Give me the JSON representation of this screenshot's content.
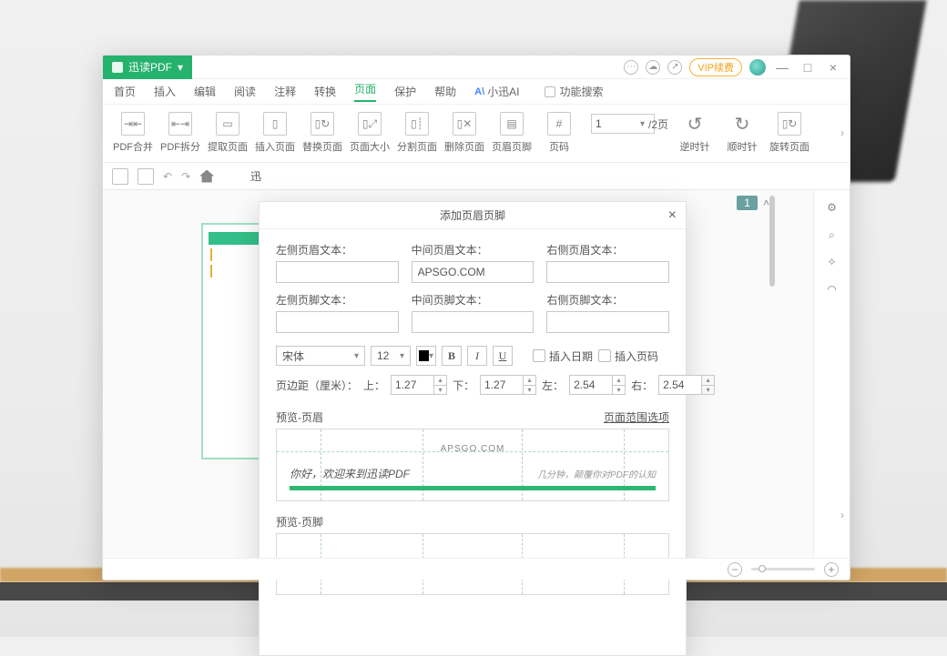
{
  "brand": "迅读PDF",
  "titlebar": {
    "vip": "VIP续费"
  },
  "menu": {
    "items": [
      "首页",
      "插入",
      "编辑",
      "阅读",
      "注释",
      "转换",
      "页面",
      "保护",
      "帮助"
    ],
    "active_index": 6,
    "ai": "小迅AI",
    "search_placeholder": "功能搜索"
  },
  "ribbon": {
    "items": [
      {
        "label": "PDF合并"
      },
      {
        "label": "PDF拆分"
      },
      {
        "label": "提取页面"
      },
      {
        "label": "插入页面"
      },
      {
        "label": "替换页面"
      },
      {
        "label": "页面大小"
      },
      {
        "label": "分割页面"
      },
      {
        "label": "删除页面"
      },
      {
        "label": "页眉页脚"
      },
      {
        "label": "页码"
      }
    ],
    "page_current": "1",
    "page_total": "/2页",
    "extra": [
      {
        "label": "逆时针"
      },
      {
        "label": "顺时针"
      },
      {
        "label": "旋转页面"
      }
    ]
  },
  "doc_tab_name": "迅",
  "page_indicator": {
    "current": "1"
  },
  "dialog": {
    "title": "添加页眉页脚",
    "fields": {
      "left_header_label": "左侧页眉文本：",
      "left_header": "",
      "mid_header_label": "中间页眉文本：",
      "mid_header": "APSGO.COM",
      "right_header_label": "右侧页眉文本：",
      "right_header": "",
      "left_footer_label": "左侧页脚文本：",
      "left_footer": "",
      "mid_footer_label": "中间页脚文本：",
      "mid_footer": "",
      "right_footer_label": "右侧页脚文本：",
      "right_footer": ""
    },
    "style": {
      "font": "宋体",
      "size": "12",
      "color": "#000000",
      "insert_date": "插入日期",
      "insert_page": "插入页码"
    },
    "margin": {
      "label": "页边距（厘米）：",
      "top_l": "上：",
      "top": "1.27",
      "bottom_l": "下：",
      "bottom": "1.27",
      "left_l": "左：",
      "left": "2.54",
      "right_l": "右：",
      "right": "2.54"
    },
    "preview_header_label": "预览-页眉",
    "page_range_option": "页面范围选项",
    "preview_header_text": "APSGO.COM",
    "welcome": "你好，欢迎来到迅读PDF",
    "welcome_sub": "几分钟，颠覆你对PDF的认知",
    "preview_footer_label": "预览-页脚"
  },
  "zoom": {
    "minus": "−",
    "plus": "+"
  }
}
